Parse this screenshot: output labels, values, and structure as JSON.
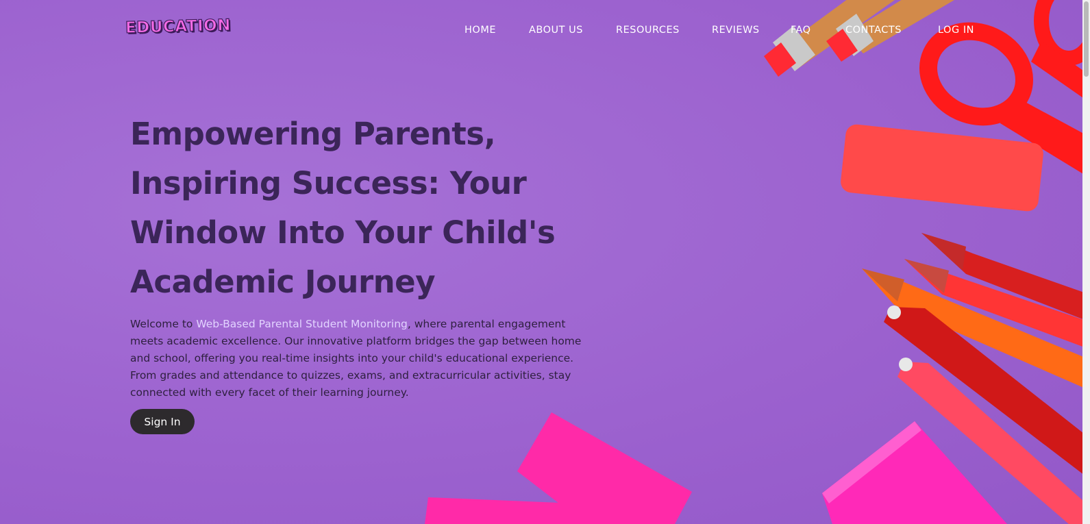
{
  "header": {
    "logo": "EDUCATION",
    "nav": [
      {
        "label": "HOME"
      },
      {
        "label": "ABOUT US"
      },
      {
        "label": "RESOURCES"
      },
      {
        "label": "REVIEWS"
      },
      {
        "label": "FAQ"
      },
      {
        "label": "CONTACTS"
      },
      {
        "label": "LOG IN"
      }
    ]
  },
  "hero": {
    "headline": "Empowering Parents, Inspiring Success: Your Window Into Your Child's Academic Journey",
    "intro_prefix": "Welcome to ",
    "intro_highlight": "Web-Based Parental Student Monitoring",
    "intro_suffix": ", where parental engagement meets academic excellence. Our innovative platform bridges the gap between home and school, offering you real-time insights into your child's educational experience. From grades and attendance to quizzes, exams, and extracurricular activities, stay connected with every facet of their learning journey.",
    "signin_label": "Sign In"
  },
  "colors": {
    "background": "#a36ad2",
    "headline": "#3b2558",
    "highlight": "#e2d3ff",
    "button": "#2d2a2d",
    "logo": "#f56be6"
  }
}
